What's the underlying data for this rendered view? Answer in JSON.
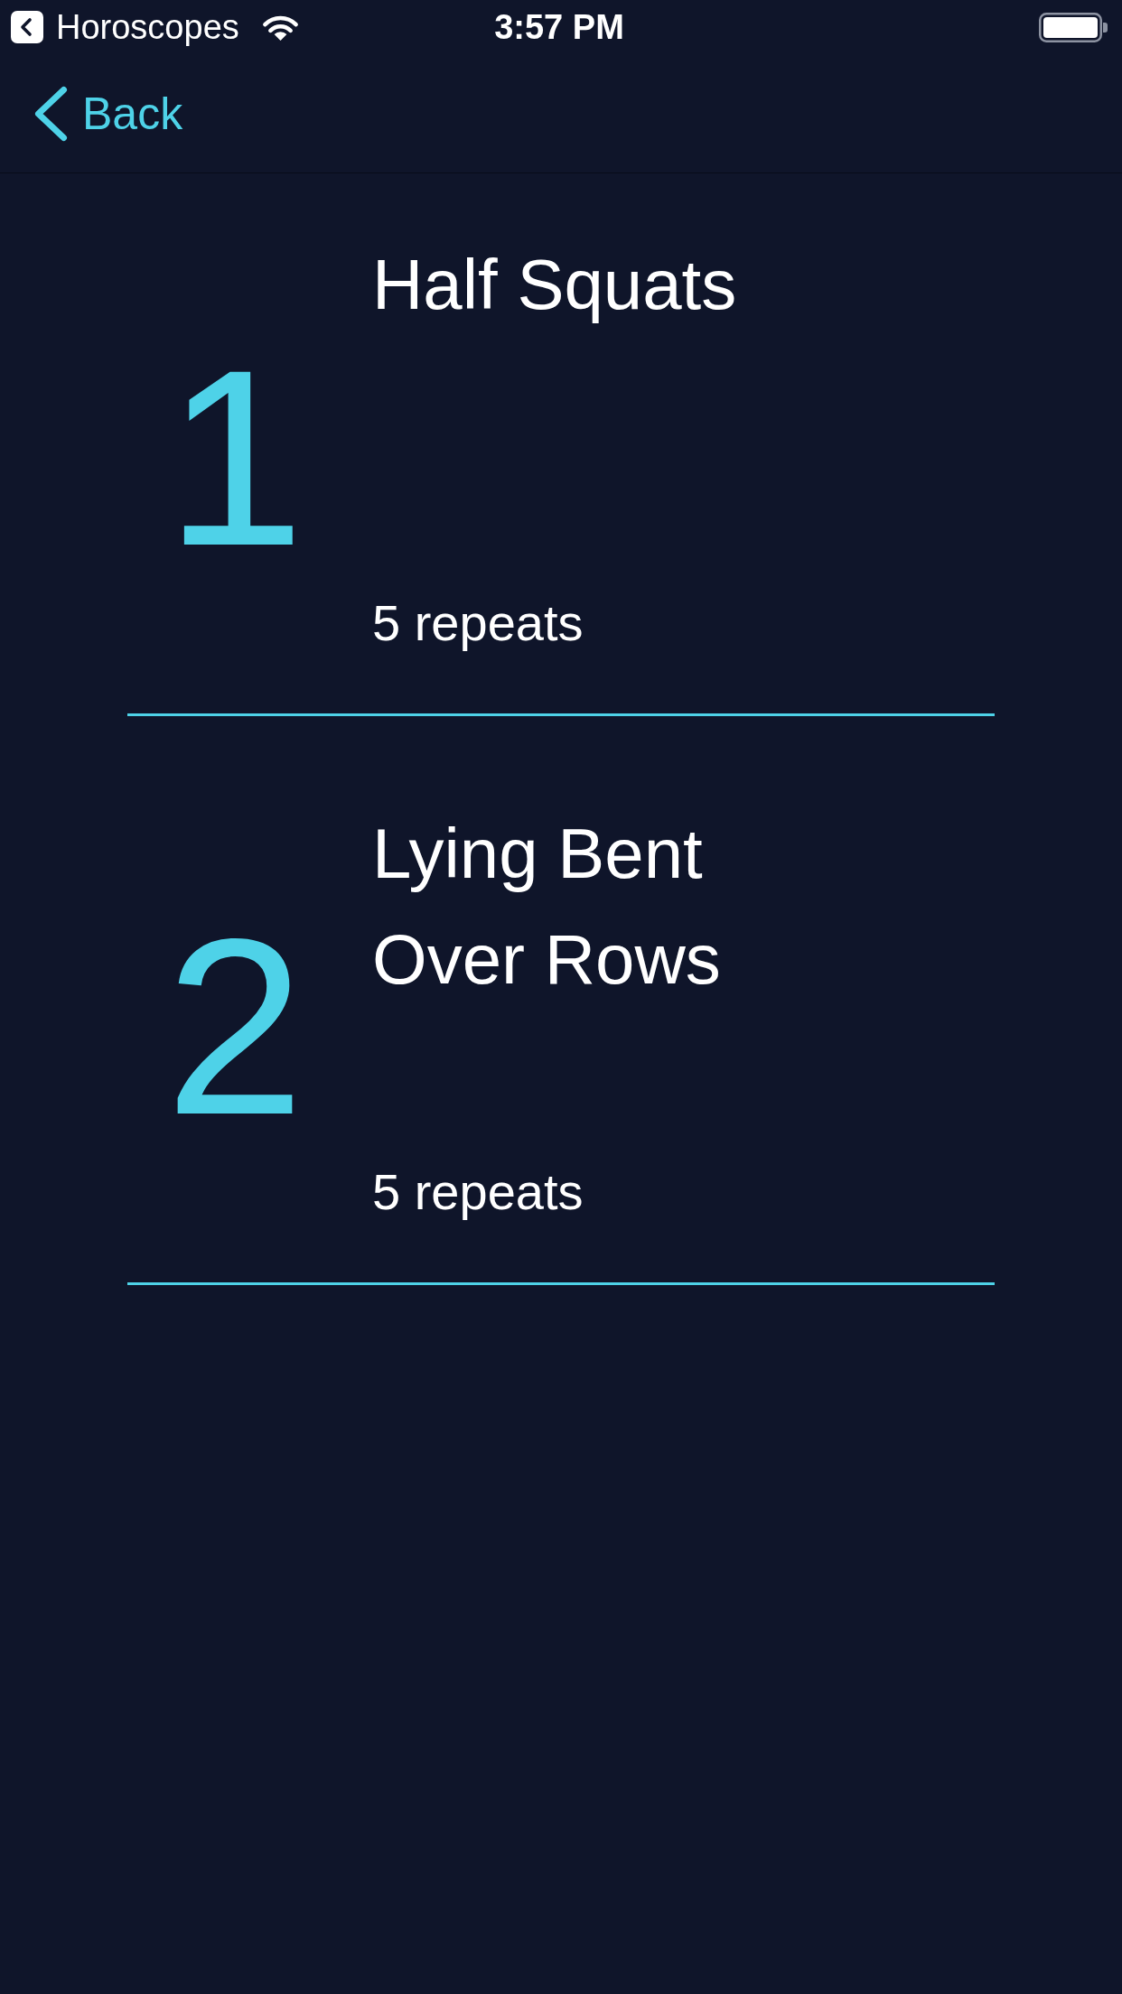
{
  "status_bar": {
    "back_to_app": "Horoscopes",
    "time": "3:57 PM"
  },
  "nav_bar": {
    "back_button": "Back"
  },
  "exercises": [
    {
      "number": "1",
      "name": "Half Squats",
      "repeats": "5 repeats"
    },
    {
      "number": "2",
      "name": "Lying Bent Over Rows",
      "repeats": "5 repeats"
    }
  ]
}
